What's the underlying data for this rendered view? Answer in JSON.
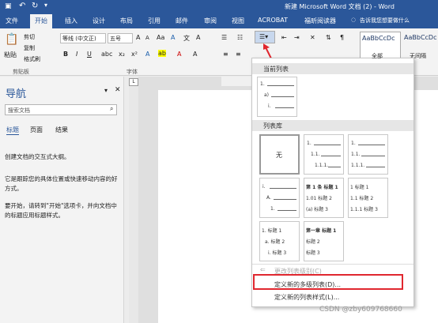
{
  "window": {
    "title": "新建 Microsoft Word 文档 (2) - Word"
  },
  "tabs": [
    "文件",
    "开始",
    "插入",
    "设计",
    "布局",
    "引用",
    "邮件",
    "审阅",
    "视图",
    "ACROBAT",
    "福昕阅读器"
  ],
  "tell_me": "告诉我您想要做什么",
  "ribbon": {
    "paste": "粘贴",
    "cut": "剪切",
    "copy": "复制",
    "format_painter": "格式刷",
    "clipboard_group": "剪贴板",
    "font_name": "等线 (中文正)",
    "font_size": "五号",
    "font_group": "字体",
    "bold": "B",
    "italic": "I",
    "underline": "U",
    "styles": [
      "AaBbCcDc",
      "AaBbCcDc"
    ],
    "style_nospacing": "无间隔",
    "all_label": "全部"
  },
  "nav": {
    "title": "导航",
    "search_placeholder": "搜索文档",
    "tabs": [
      "标题",
      "页面",
      "结果"
    ],
    "text1": "创建文档的交互式大纲。",
    "text2": "它是跟踪您的具体位置或快速移动内容的好方式。",
    "text3": "要开始，请转到\"开始\"选项卡，并向文档中的标题应用标题样式。"
  },
  "dropdown": {
    "current_list_header": "当前列表",
    "library_header": "列表库",
    "none_label": "无",
    "current": [
      "1.",
      "a)",
      "i."
    ],
    "lib1": [
      "1.",
      "1.1.",
      "1.1.1."
    ],
    "lib2": [
      "1)",
      "a)",
      "i)"
    ],
    "lib3": [
      "i.",
      "A.",
      "1."
    ],
    "lib4": [
      "第 1 条 标题 1",
      "1.01 标题 2",
      "(a) 标题 3"
    ],
    "lib5": [
      "1 标题 1",
      "1.1 标题 2",
      "1.1.1 标题 3"
    ],
    "lib6": [
      "1. 标题 1",
      "a. 标题 2",
      "i. 标题 3"
    ],
    "lib7": [
      "第一章 标题 1",
      "标题 2",
      "标题 3"
    ],
    "menu_change_level": "更改列表级别(C)",
    "menu_define_multilevel": "定义新的多级列表(D)...",
    "menu_define_style": "定义新的列表样式(L)..."
  },
  "watermark": "CSDN @zby609768660",
  "colors": {
    "accent": "#2b579a",
    "highlight_border": "#e0272f",
    "arrow": "#e0272f"
  }
}
